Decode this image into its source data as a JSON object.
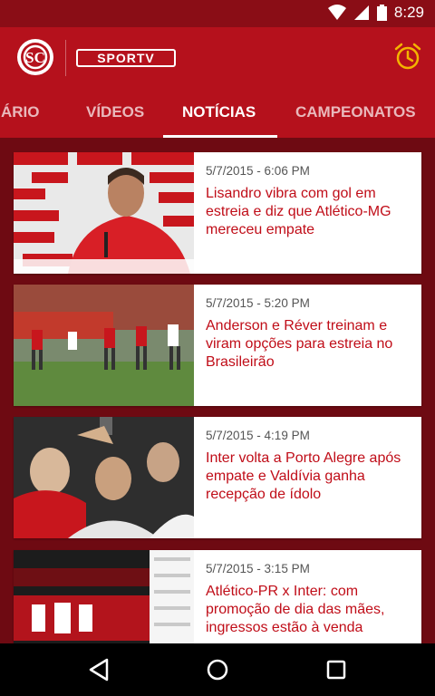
{
  "status": {
    "time": "8:29"
  },
  "appbar": {
    "brand": "SPORTV"
  },
  "tabs": [
    {
      "label": "DIÁRIO"
    },
    {
      "label": "VÍDEOS"
    },
    {
      "label": "NOTÍCIAS"
    },
    {
      "label": "CAMPEONATOS"
    }
  ],
  "articles": [
    {
      "date": "5/7/2015 - 6:06 PM",
      "title": "Lisandro vibra com gol em estreia e diz que Atlético-MG mereceu empate"
    },
    {
      "date": "5/7/2015 - 5:20 PM",
      "title": "Anderson e Réver treinam e viram opções para estreia no Brasileirão"
    },
    {
      "date": "5/7/2015 - 4:19 PM",
      "title": "Inter volta a Porto Alegre após empate e Valdívia ganha recepção de ídolo"
    },
    {
      "date": "5/7/2015 - 3:15 PM",
      "title": "Atlético-PR x Inter: com promoção de dia das mães, ingressos estão à venda"
    }
  ],
  "colors": {
    "primary": "#b5111c",
    "dark": "#6e0a12",
    "accent_text": "#c00d18"
  }
}
